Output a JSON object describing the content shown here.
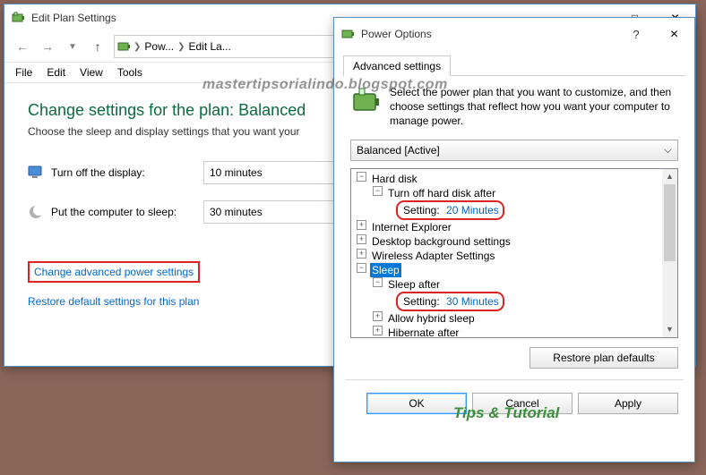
{
  "main_window": {
    "title": "Edit Plan Settings",
    "breadcrumb": {
      "item1": "Pow...",
      "item2": "Edit La..."
    },
    "menu": {
      "file": "File",
      "edit": "Edit",
      "view": "View",
      "tools": "Tools"
    },
    "heading": "Change settings for the plan: Balanced",
    "subheading": "Choose the sleep and display settings that you want your",
    "display_row": {
      "label": "Turn off the display:",
      "value": "10 minutes"
    },
    "sleep_row": {
      "label": "Put the computer to sleep:",
      "value": "30 minutes"
    },
    "link_advanced": "Change advanced power settings",
    "link_restore": "Restore default settings for this plan"
  },
  "dialog": {
    "title": "Power Options",
    "tab": "Advanced settings",
    "description": "Select the power plan that you want to customize, and then choose settings that reflect how you want your computer to manage power.",
    "plan": "Balanced [Active]",
    "tree": {
      "hard_disk": "Hard disk",
      "turn_off_after": "Turn off hard disk after",
      "hd_setting_label": "Setting:",
      "hd_setting_value": "20 Minutes",
      "ie": "Internet Explorer",
      "desktop_bg": "Desktop background settings",
      "wireless": "Wireless Adapter Settings",
      "sleep": "Sleep",
      "sleep_after": "Sleep after",
      "sleep_setting_label": "Setting:",
      "sleep_setting_value": "30 Minutes",
      "allow_hybrid": "Allow hybrid sleep",
      "hibernate": "Hibernate after"
    },
    "restore_defaults": "Restore plan defaults",
    "ok": "OK",
    "cancel": "Cancel",
    "apply": "Apply"
  },
  "watermarks": {
    "top": "mastertipsorialindo.blogspot.com",
    "bottom": "Tips & Tutorial"
  }
}
